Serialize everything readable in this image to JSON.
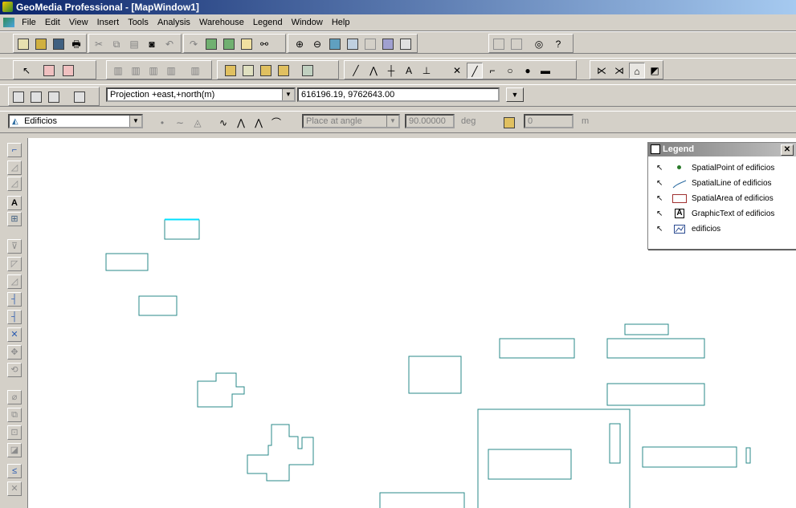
{
  "window": {
    "title": "GeoMedia Professional - [MapWindow1]"
  },
  "menu": [
    "File",
    "Edit",
    "View",
    "Insert",
    "Tools",
    "Analysis",
    "Warehouse",
    "Legend",
    "Window",
    "Help"
  ],
  "toolbar": {
    "projection": "Projection +east,+north(m)",
    "coordinates": "616196.19, 9762643.00",
    "feature_class": "Edificios",
    "placement_mode": "Place at angle",
    "angle_value": "90.00000",
    "angle_unit": "deg",
    "distance_value": "0",
    "distance_unit": "m"
  },
  "legend": {
    "title": "Legend",
    "entries": [
      "SpatialPoint of edificios",
      "SpatialLine of edificios",
      "SpatialArea of edificios",
      "GraphicText of edificios",
      "edificios"
    ]
  },
  "map": {
    "feature_color": "#2a8a8a",
    "highlight_color": "#00e0ff"
  },
  "icons": {
    "app": "geomedia-app-icon",
    "legend_close": "close-icon",
    "legend_window": "legend-icon"
  }
}
